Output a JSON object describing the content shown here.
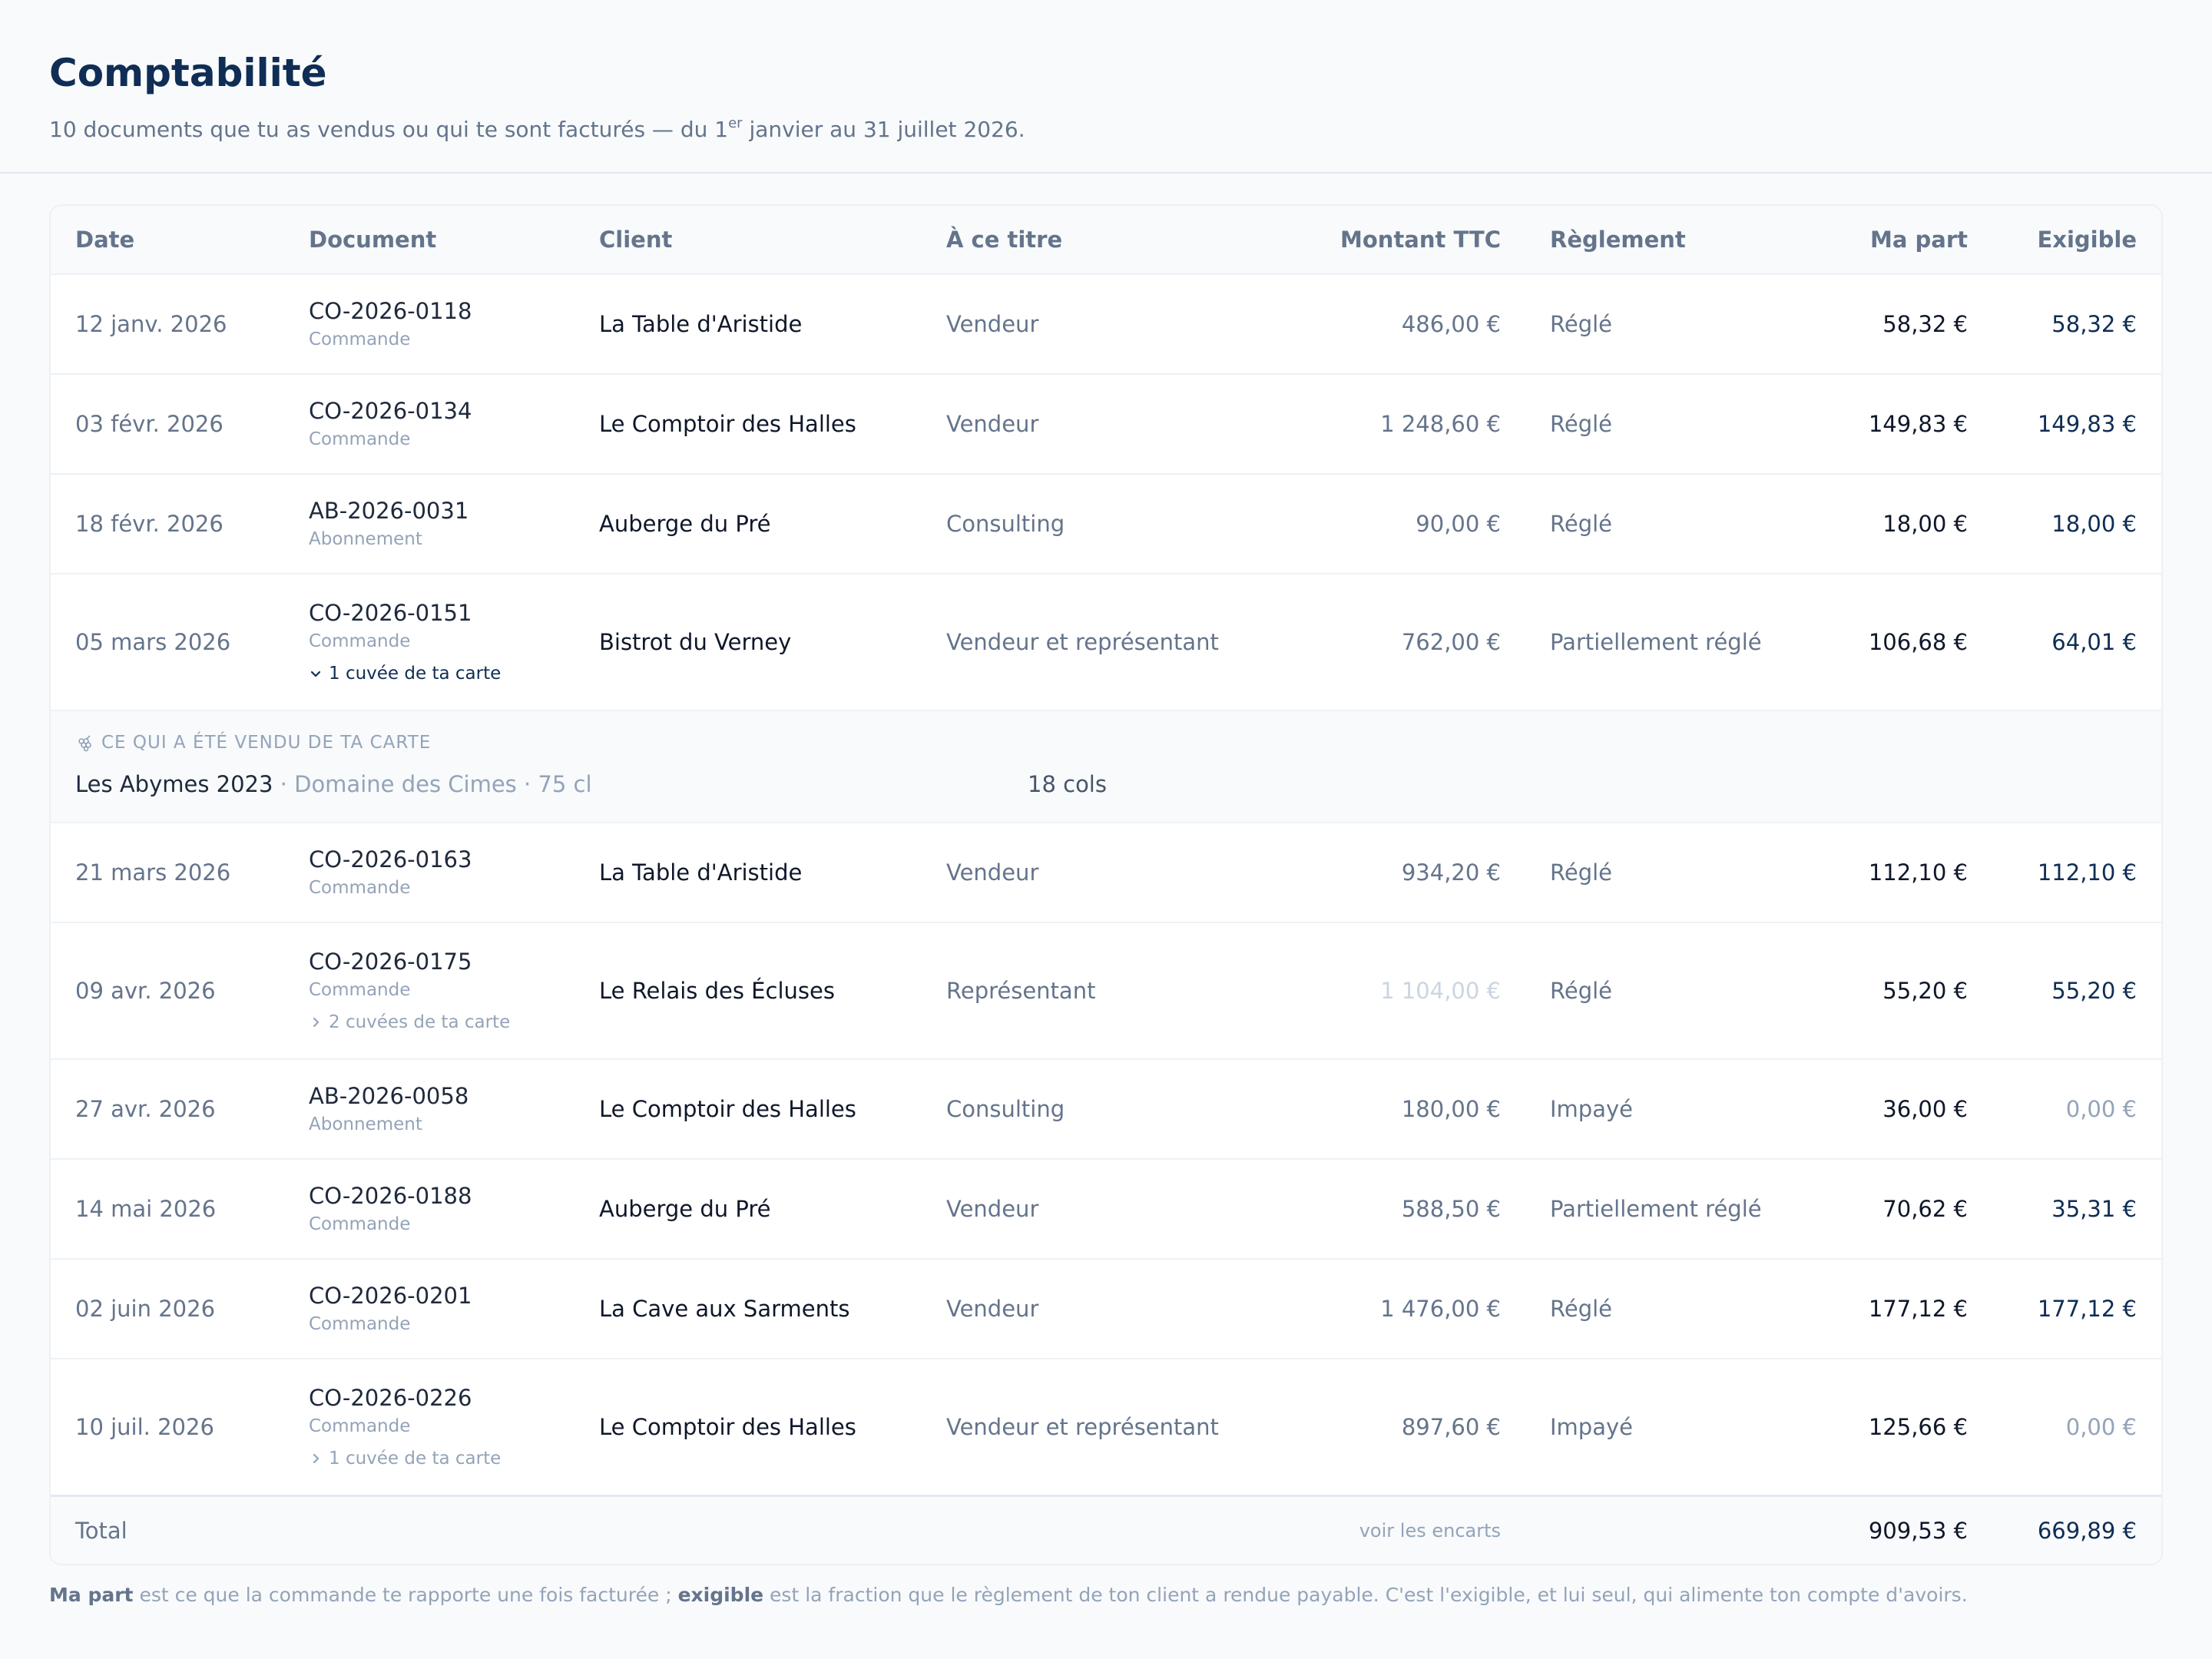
{
  "header": {
    "title": "Comptabilité",
    "subtitle_pre": "10 documents que tu as vendus ou qui te sont facturés — du 1",
    "subtitle_sup": "er",
    "subtitle_post": " janvier au 31 juillet 2026."
  },
  "columns": {
    "date": "Date",
    "document": "Document",
    "client": "Client",
    "titre": "À ce titre",
    "montant": "Montant TTC",
    "reglement": "Règlement",
    "part": "Ma part",
    "exigible": "Exigible"
  },
  "rows": [
    {
      "date": "12 janv. 2026",
      "doc": "CO-2026-0118",
      "type": "Commande",
      "client": "La Table d'Aristide",
      "titre": "Vendeur",
      "montant": "486,00 €",
      "reglement": "Réglé",
      "part": "58,32 €",
      "exigible": "58,32 €"
    },
    {
      "date": "03 févr. 2026",
      "doc": "CO-2026-0134",
      "type": "Commande",
      "client": "Le Comptoir des Halles",
      "titre": "Vendeur",
      "montant": "1 248,60 €",
      "reglement": "Réglé",
      "part": "149,83 €",
      "exigible": "149,83 €"
    },
    {
      "date": "18 févr. 2026",
      "doc": "AB-2026-0031",
      "type": "Abonnement",
      "client": "Auberge du Pré",
      "titre": "Consulting",
      "montant": "90,00 €",
      "reglement": "Réglé",
      "part": "18,00 €",
      "exigible": "18,00 €"
    },
    {
      "date": "05 mars 2026",
      "doc": "CO-2026-0151",
      "type": "Commande",
      "cuvee": "1 cuvée de ta carte",
      "client": "Bistrot du Verney",
      "titre": "Vendeur et représentant",
      "montant": "762,00 €",
      "reglement": "Partiellement réglé",
      "part": "106,68 €",
      "exigible": "64,01 €"
    },
    {
      "date": "21 mars 2026",
      "doc": "CO-2026-0163",
      "type": "Commande",
      "client": "La Table d'Aristide",
      "titre": "Vendeur",
      "montant": "934,20 €",
      "reglement": "Réglé",
      "part": "112,10 €",
      "exigible": "112,10 €"
    },
    {
      "date": "09 avr. 2026",
      "doc": "CO-2026-0175",
      "type": "Commande",
      "cuvee": "2 cuvées de ta carte",
      "client": "Le Relais des Écluses",
      "titre": "Représentant",
      "montant": "1 104,00 €",
      "reglement": "Réglé",
      "part": "55,20 €",
      "exigible": "55,20 €"
    },
    {
      "date": "27 avr. 2026",
      "doc": "AB-2026-0058",
      "type": "Abonnement",
      "client": "Le Comptoir des Halles",
      "titre": "Consulting",
      "montant": "180,00 €",
      "reglement": "Impayé",
      "part": "36,00 €",
      "exigible": "0,00 €"
    },
    {
      "date": "14 mai 2026",
      "doc": "CO-2026-0188",
      "type": "Commande",
      "client": "Auberge du Pré",
      "titre": "Vendeur",
      "montant": "588,50 €",
      "reglement": "Partiellement réglé",
      "part": "70,62 €",
      "exigible": "35,31 €"
    },
    {
      "date": "02 juin 2026",
      "doc": "CO-2026-0201",
      "type": "Commande",
      "client": "La Cave aux Sarments",
      "titre": "Vendeur",
      "montant": "1 476,00 €",
      "reglement": "Réglé",
      "part": "177,12 €",
      "exigible": "177,12 €"
    },
    {
      "date": "10 juil. 2026",
      "doc": "CO-2026-0226",
      "type": "Commande",
      "cuvee": "1 cuvée de ta carte",
      "client": "Le Comptoir des Halles",
      "titre": "Vendeur et représentant",
      "montant": "897,60 €",
      "reglement": "Impayé",
      "part": "125,66 €",
      "exigible": "0,00 €"
    }
  ],
  "expanded": {
    "label": "CE QUI A ÉTÉ VENDU DE TA CARTE",
    "wine_name": "Les Abymes 2023",
    "wine_meta": " · Domaine des Cimes · 75 cl",
    "quantity": "18 cols"
  },
  "total": {
    "label": "Total",
    "link": "voir les encarts",
    "part": "909,53 €",
    "exigible": "669,89 €"
  },
  "footnote": {
    "b1": "Ma part",
    "t1": " est ce que la commande te rapporte une fois facturée ; ",
    "b2": "exigible",
    "t2": " est la fraction que le règlement de ton client a rendue payable. C'est l'exigible, et lui seul, qui alimente ton compte d'avoirs."
  },
  "colors": {
    "title": "#0f2d55",
    "muted": "#94a3b8",
    "text": "#0f172a"
  }
}
